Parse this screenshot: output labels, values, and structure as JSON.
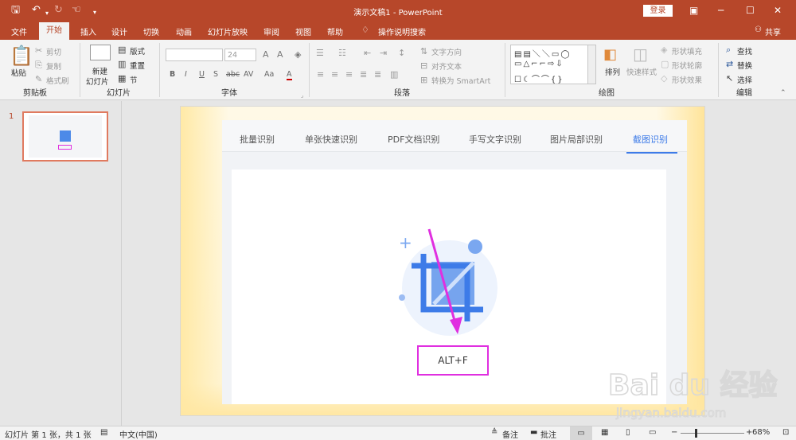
{
  "titlebar": {
    "title": "演示文稿1  -  PowerPoint",
    "login_label": "登录"
  },
  "tabs": [
    {
      "label": "文件"
    },
    {
      "label": "开始"
    },
    {
      "label": "插入"
    },
    {
      "label": "设计"
    },
    {
      "label": "切换"
    },
    {
      "label": "动画"
    },
    {
      "label": "幻灯片放映"
    },
    {
      "label": "审阅"
    },
    {
      "label": "视图"
    },
    {
      "label": "帮助"
    },
    {
      "label": "操作说明搜索"
    }
  ],
  "share_label": "共享",
  "ribbon": {
    "clipboard": {
      "paste": "粘贴",
      "cut": "剪切",
      "copy": "复制",
      "painter": "格式刷",
      "group": "剪贴板"
    },
    "slides": {
      "new_line1": "新建",
      "new_line2": "幻灯片",
      "layout": "版式",
      "reset": "重置",
      "section": "节",
      "group": "幻灯片"
    },
    "font": {
      "size": "24",
      "bold": "B",
      "italic": "I",
      "underline": "U",
      "shadow": "S",
      "strike": "abc",
      "spacing": "AV",
      "case": "Aa",
      "color": "A",
      "group": "字体"
    },
    "paragraph": {
      "direction": "文字方向",
      "align": "对齐文本",
      "smartart": "转换为 SmartArt",
      "group": "段落"
    },
    "drawing": {
      "arrange": "排列",
      "quick_style": "快速样式",
      "fill": "形状填充",
      "outline": "形状轮廓",
      "effect": "形状效果",
      "group": "绘图"
    },
    "editing": {
      "find": "查找",
      "replace": "替换",
      "select": "选择",
      "group": "编辑"
    }
  },
  "thumbnail": {
    "number": "1"
  },
  "slide": {
    "tabs": [
      "批量识别",
      "单张快速识别",
      "PDF文档识别",
      "手写文字识别",
      "图片局部识别",
      "截图识别"
    ],
    "hotkey": "ALT+F"
  },
  "statusbar": {
    "slide_info": "幻灯片 第 1 张，共 1 张",
    "language": "中文(中国)",
    "notes": "备注",
    "comments": "批注",
    "zoom": "68%"
  },
  "watermark": {
    "brand": "Bai du 经验",
    "url": "jingyan.baidu.com"
  },
  "colors": {
    "accent": "#b7472a",
    "highlight": "#e02fe0",
    "tab_blue": "#3d7be8"
  }
}
